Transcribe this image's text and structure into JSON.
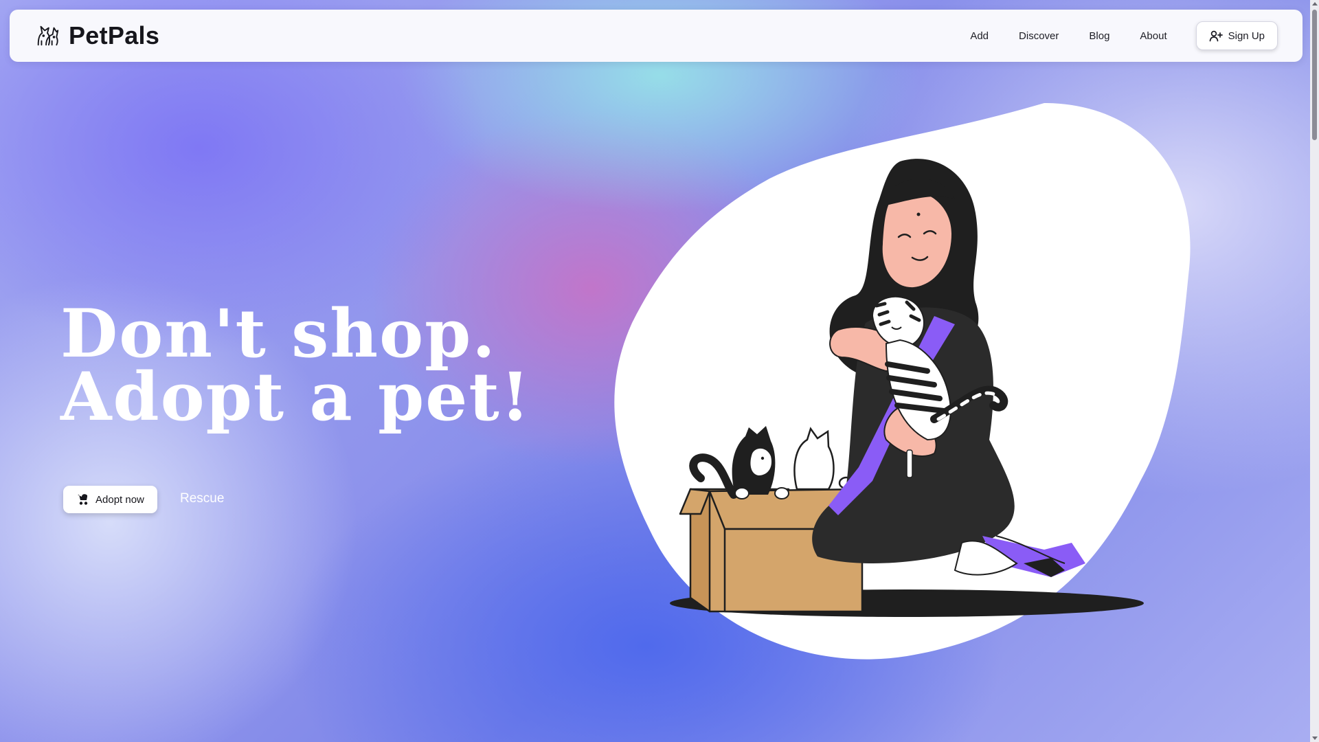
{
  "navbar": {
    "brand_name": "PetPals",
    "logo_icon": "pets-icon",
    "links": [
      "Add",
      "Discover",
      "Blog",
      "About"
    ],
    "signup_label": "Sign Up",
    "signup_icon": "user-plus-icon"
  },
  "hero": {
    "title_line1": "Don't shop.",
    "title_line2": "Adopt a pet!",
    "adopt_label": "Adopt now",
    "adopt_icon": "stroller-icon",
    "rescue_label": "Rescue"
  },
  "illustration": {
    "description_icon": "woman-with-cats-illustration"
  },
  "colors": {
    "accent_purple": "#8a5cf6",
    "box_tan": "#d4a56b",
    "dark": "#242424",
    "skin": "#f7b8a8"
  }
}
